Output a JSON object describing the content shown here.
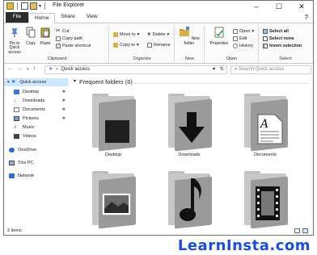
{
  "window": {
    "title": "File Explorer"
  },
  "tabs": [
    "File",
    "Home",
    "Share",
    "View"
  ],
  "ribbon": {
    "clipboard": {
      "pin": "Pin to Quick access",
      "copy": "Copy",
      "paste": "Paste",
      "cut": "Cut",
      "copy_path": "Copy path",
      "paste_shortcut": "Paste shortcut",
      "label": "Clipboard"
    },
    "organize": {
      "move_to": "Move to",
      "copy_to": "Copy to",
      "delete": "Delete",
      "rename": "Rename",
      "label": "Organize"
    },
    "new": {
      "new_folder": "New folder",
      "label": "New"
    },
    "open": {
      "properties": "Properties",
      "open": "Open",
      "edit": "Edit",
      "history": "History",
      "label": "Open"
    },
    "select": {
      "select_all": "Select all",
      "select_none": "Select none",
      "invert": "Invert selection",
      "label": "Select"
    }
  },
  "address": {
    "path": "Quick access",
    "search_placeholder": "Search Quick access"
  },
  "navpane": {
    "items": [
      {
        "label": "Quick access",
        "pinned": false
      },
      {
        "label": "Desktop",
        "pinned": true
      },
      {
        "label": "Downloads",
        "pinned": true
      },
      {
        "label": "Documents",
        "pinned": true
      },
      {
        "label": "Pictures",
        "pinned": true
      },
      {
        "label": "Music",
        "pinned": false
      },
      {
        "label": "Videos",
        "pinned": false
      },
      {
        "label": "OneDrive",
        "pinned": false
      },
      {
        "label": "This PC",
        "pinned": false
      },
      {
        "label": "Network",
        "pinned": false
      }
    ]
  },
  "content": {
    "section": "Frequent folders (6)",
    "folders": [
      {
        "label": "Desktop",
        "icon": "desktop-icon"
      },
      {
        "label": "Downloads",
        "icon": "download-arrow-icon"
      },
      {
        "label": "Documents",
        "icon": "document-icon"
      },
      {
        "label": "",
        "icon": "pictures-icon"
      },
      {
        "label": "",
        "icon": "music-note-icon"
      },
      {
        "label": "",
        "icon": "film-icon"
      }
    ]
  },
  "status": {
    "items": "2 items"
  },
  "brand": "LearnInsta.com",
  "colors": {
    "accent": "#1f4fd1",
    "selected": "#cde8ff"
  }
}
